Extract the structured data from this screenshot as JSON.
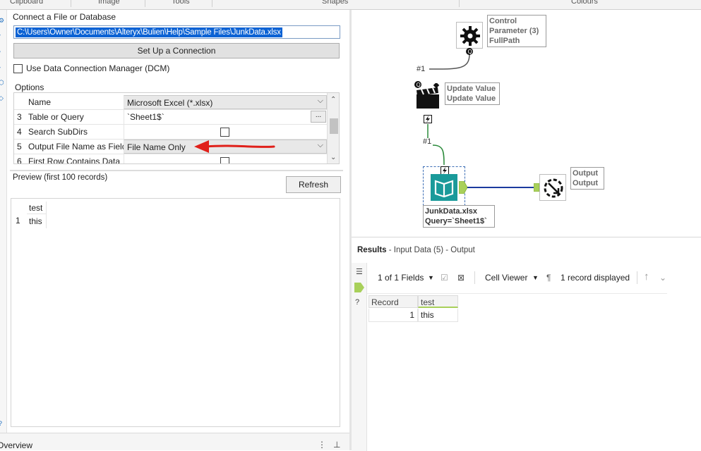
{
  "ribbon": {
    "groups": [
      "Clipboard",
      "Image",
      "Tools",
      "Shapes",
      "Colours"
    ]
  },
  "config": {
    "connect_label": "Connect a File or Database",
    "file_path": "C:\\Users\\Owner\\Documents\\Alteryx\\Bulien\\Help\\Sample Files\\JunkData.xlsx",
    "setup_button": "Set Up a Connection",
    "dcm_label": "Use Data Connection Manager (DCM)",
    "options_label": "Options",
    "options": [
      {
        "num": "",
        "name": "Name",
        "value": "Microsoft Excel (*.xlsx)"
      },
      {
        "num": "3",
        "name": "Table or Query",
        "value": "`Sheet1$`",
        "button": "..."
      },
      {
        "num": "4",
        "name": "Search SubDirs",
        "value": ""
      },
      {
        "num": "5",
        "name": "Output File Name as Field",
        "value": "File Name Only"
      },
      {
        "num": "6",
        "name": "First Row Contains Data",
        "value": ""
      }
    ],
    "preview_label": "Preview (first 100 records)",
    "refresh_button": "Refresh",
    "preview": {
      "header": "test",
      "row_num": "1",
      "cell": "this"
    }
  },
  "overview": {
    "title": "Overview"
  },
  "canvas": {
    "control_label": [
      "Control",
      "Parameter (3)",
      "FullPath"
    ],
    "update_label": [
      "Update Value",
      "Update Value"
    ],
    "conn1": "#1",
    "conn2": "#1",
    "input_label": [
      "JunkData.xlsx",
      "Query=`Sheet1$`"
    ],
    "output_label": [
      "Output",
      "Output"
    ]
  },
  "results": {
    "title_bold": "Results",
    "title_rest": " - Input Data (5) - Output",
    "fields": "1 of 1 Fields",
    "cell_viewer": "Cell Viewer",
    "records_displayed": "1 record displayed",
    "grid": {
      "h_record": "Record",
      "h_test": "test",
      "rec": "1",
      "val": "this"
    }
  },
  "colors": {
    "selection": "#0b62d4",
    "annotation_arrow": "#e0201a",
    "tool_teal": "#1a9a9a",
    "connection_blue": "#1b3a9e",
    "anchor_green": "#a8d05a"
  }
}
